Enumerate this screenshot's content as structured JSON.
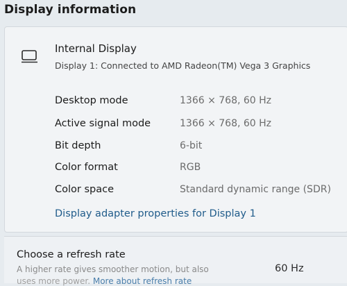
{
  "page": {
    "title": "Display information"
  },
  "display": {
    "name": "Internal Display",
    "connection": "Display 1: Connected to AMD Radeon(TM) Vega 3 Graphics",
    "icon": "monitor-icon"
  },
  "properties": [
    {
      "label": "Desktop mode",
      "value": "1366 × 768, 60 Hz"
    },
    {
      "label": "Active signal mode",
      "value": "1366 × 768, 60 Hz"
    },
    {
      "label": "Bit depth",
      "value": "6-bit"
    },
    {
      "label": "Color format",
      "value": "RGB"
    },
    {
      "label": "Color space",
      "value": "Standard dynamic range (SDR)"
    }
  ],
  "adapter_link": "Display adapter properties for Display 1",
  "refresh": {
    "title": "Choose a refresh rate",
    "description": "A higher rate gives smoother motion, but also",
    "description_line2": "uses more power.",
    "more_link": "More about refresh rate",
    "selected": "60 Hz"
  }
}
